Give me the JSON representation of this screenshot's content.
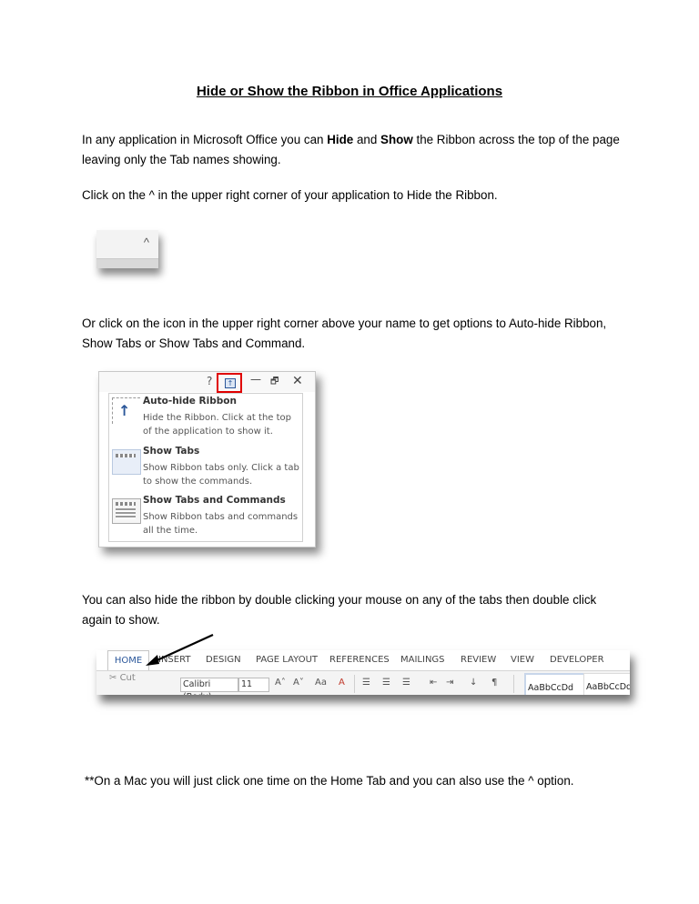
{
  "title": "Hide or Show the Ribbon in Office Applications",
  "intro": {
    "part1": "In any application in Microsoft Office you can ",
    "bold1": "Hide",
    "part2": " and ",
    "bold2": "Show",
    "part3": " the Ribbon across the top of the page leaving only the Tab names showing."
  },
  "step_caret": "Click on the ^ in the upper right corner of your application to Hide the Ribbon.",
  "step_icon": "Or click on the icon in the upper right corner above your name to get options to Auto-hide Ribbon, Show Tabs or Show Tabs and Command.",
  "step_double_click": "You can also hide the ribbon by double clicking your mouse on any of the tabs then double click again to show.",
  "mac_note": "**On a Mac you will just click one time on the Home Tab and you can also use the ^ option.",
  "caret_shot": {
    "caret": "^"
  },
  "options_shot": {
    "help": "?",
    "minimize": "—",
    "restore": "🗗",
    "close": "✕",
    "items": [
      {
        "heading": "Auto-hide Ribbon",
        "description": "Hide the Ribbon. Click at the top of the application to show it.",
        "icon": "arrow-up-icon"
      },
      {
        "heading": "Show Tabs",
        "description": "Show Ribbon tabs only. Click a tab to show the commands.",
        "icon": "tabs-only-icon"
      },
      {
        "heading": "Show Tabs and Commands",
        "description": "Show Ribbon tabs and commands all the time.",
        "icon": "tabs-commands-icon"
      }
    ],
    "highlight_color": "#e00000"
  },
  "ribbon_shot": {
    "tabs": [
      "HOME",
      "INSERT",
      "DESIGN",
      "PAGE LAYOUT",
      "REFERENCES",
      "MAILINGS",
      "REVIEW",
      "VIEW",
      "DEVELOPER"
    ],
    "cut": "Cut",
    "font": "Calibri (Body)",
    "size": "11",
    "grow": "A˄",
    "shrink": "A˅",
    "case": "Aa",
    "style1": "AaBbCcDd",
    "style2": "AaBbCcDd",
    "accent": "#2b579a"
  }
}
